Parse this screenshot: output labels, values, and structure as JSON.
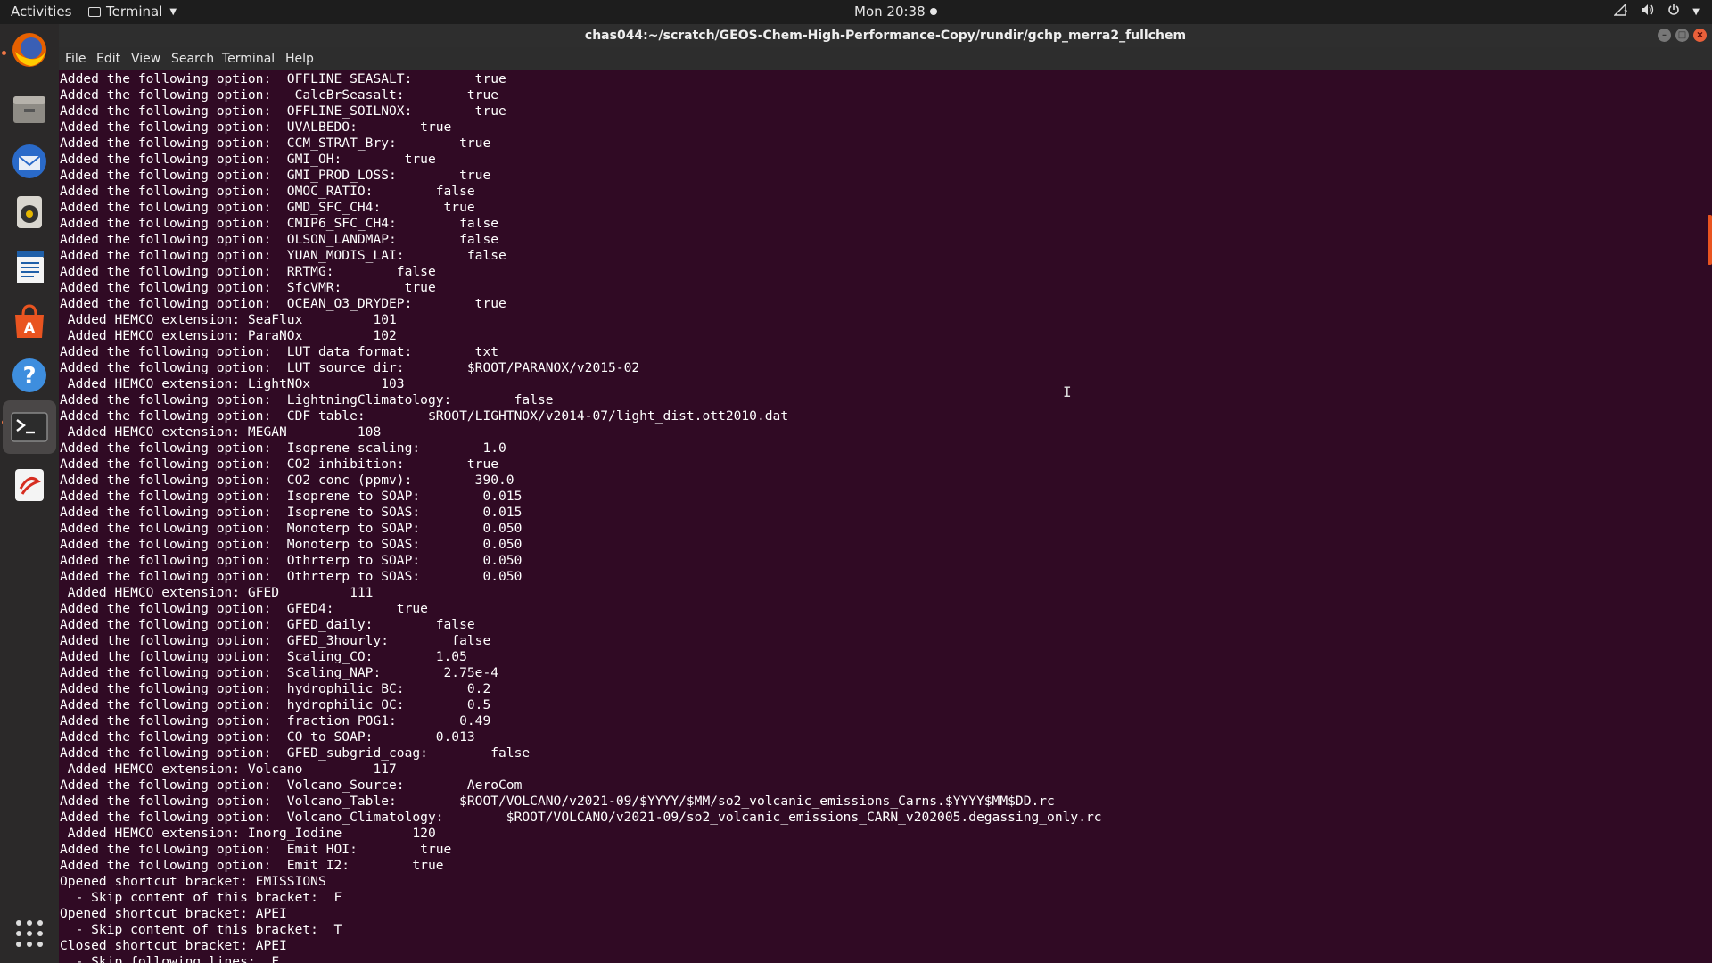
{
  "topbar": {
    "activities": "Activities",
    "app_name": "Terminal",
    "clock": "Mon 20:38"
  },
  "window": {
    "title": "chas044:~/scratch/GEOS-Chem-High-Performance-Copy/rundir/gchp_merra2_fullchem"
  },
  "menu": [
    "File",
    "Edit",
    "View",
    "Search",
    "Terminal",
    "Help"
  ],
  "dock": {
    "items": [
      "firefox-icon",
      "files-icon",
      "thunderbird-icon",
      "rhythmbox-icon",
      "libreoffice-writer-icon",
      "software-center-icon",
      "help-icon",
      "terminal-icon",
      "text-editor-icon"
    ],
    "apps_grid": "show-applications-icon"
  },
  "terminal": {
    "lines": [
      "Added the following option:  OFFLINE_SEASALT:        true",
      "Added the following option:   CalcBrSeasalt:        true",
      "Added the following option:  OFFLINE_SOILNOX:        true",
      "Added the following option:  UVALBEDO:        true",
      "Added the following option:  CCM_STRAT_Bry:        true",
      "Added the following option:  GMI_OH:        true",
      "Added the following option:  GMI_PROD_LOSS:        true",
      "Added the following option:  OMOC_RATIO:        false",
      "Added the following option:  GMD_SFC_CH4:        true",
      "Added the following option:  CMIP6_SFC_CH4:        false",
      "Added the following option:  OLSON_LANDMAP:        false",
      "Added the following option:  YUAN_MODIS_LAI:        false",
      "Added the following option:  RRTMG:        false",
      "Added the following option:  SfcVMR:        true",
      "Added the following option:  OCEAN_O3_DRYDEP:        true",
      " Added HEMCO extension: SeaFlux         101",
      " Added HEMCO extension: ParaNOx         102",
      "Added the following option:  LUT data format:        txt",
      "Added the following option:  LUT source dir:        $ROOT/PARANOX/v2015-02",
      " Added HEMCO extension: LightNOx         103",
      "Added the following option:  LightningClimatology:        false",
      "Added the following option:  CDF table:        $ROOT/LIGHTNOX/v2014-07/light_dist.ott2010.dat",
      " Added HEMCO extension: MEGAN         108",
      "Added the following option:  Isoprene scaling:        1.0",
      "Added the following option:  CO2 inhibition:        true",
      "Added the following option:  CO2 conc (ppmv):        390.0",
      "Added the following option:  Isoprene to SOAP:        0.015",
      "Added the following option:  Isoprene to SOAS:        0.015",
      "Added the following option:  Monoterp to SOAP:        0.050",
      "Added the following option:  Monoterp to SOAS:        0.050",
      "Added the following option:  Othrterp to SOAP:        0.050",
      "Added the following option:  Othrterp to SOAS:        0.050",
      " Added HEMCO extension: GFED         111",
      "Added the following option:  GFED4:        true",
      "Added the following option:  GFED_daily:        false",
      "Added the following option:  GFED_3hourly:        false",
      "Added the following option:  Scaling_CO:        1.05",
      "Added the following option:  Scaling_NAP:        2.75e-4",
      "Added the following option:  hydrophilic BC:        0.2",
      "Added the following option:  hydrophilic OC:        0.5",
      "Added the following option:  fraction POG1:        0.49",
      "Added the following option:  CO to SOAP:        0.013",
      "Added the following option:  GFED_subgrid_coag:        false",
      " Added HEMCO extension: Volcano         117",
      "Added the following option:  Volcano_Source:        AeroCom",
      "Added the following option:  Volcano_Table:        $ROOT/VOLCANO/v2021-09/$YYYY/$MM/so2_volcanic_emissions_Carns.$YYYY$MM$DD.rc",
      "Added the following option:  Volcano_Climatology:        $ROOT/VOLCANO/v2021-09/so2_volcanic_emissions_CARN_v202005.degassing_only.rc",
      " Added HEMCO extension: Inorg_Iodine         120",
      "Added the following option:  Emit HOI:        true",
      "Added the following option:  Emit I2:        true",
      "Opened shortcut bracket: EMISSIONS",
      "  - Skip content of this bracket:  F",
      "Opened shortcut bracket: APEI",
      "  - Skip content of this bracket:  T",
      "Closed shortcut bracket: APEI",
      "  - Skip following lines:  F"
    ]
  },
  "colors": {
    "terminal_bg": "#300a24",
    "accent": "#e95420"
  }
}
